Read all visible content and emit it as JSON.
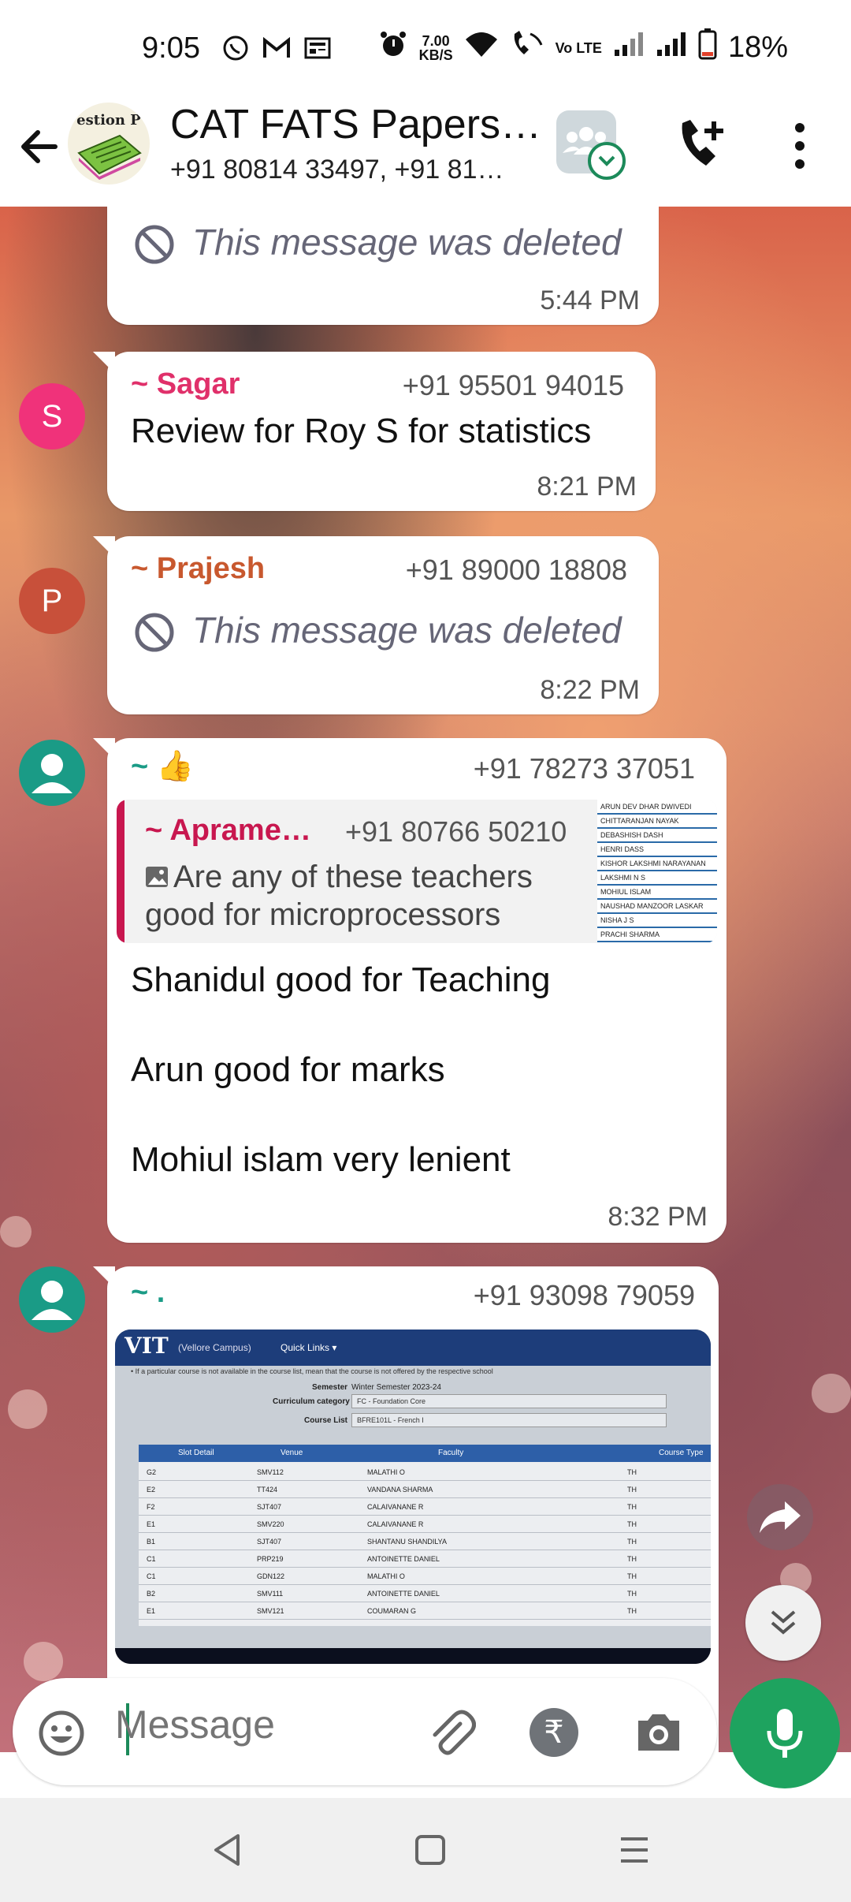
{
  "status_bar": {
    "time": "9:05",
    "speed_value": "7.00",
    "speed_unit": "KB/S",
    "volte": "Vo LTE",
    "battery": "18%"
  },
  "header": {
    "title": "CAT FATS Papers…",
    "subtitle": "+91 80814 33497, +91 81…",
    "avatar_text": "estion P"
  },
  "messages": [
    {
      "deleted_text": "This message was deleted",
      "time": "5:44 PM"
    },
    {
      "avatar_letter": "S",
      "avatar_color": "#f0327a",
      "sender": "~ Sagar",
      "sender_color": "#e0306a",
      "phone": "+91 95501 94015",
      "text": "Review for Roy S for statistics",
      "time": "8:21 PM"
    },
    {
      "avatar_letter": "P",
      "avatar_color": "#c8503a",
      "sender": "~ Prajesh",
      "sender_color": "#c8582e",
      "phone": "+91 89000 18808",
      "deleted_text": "This message was deleted",
      "time": "8:22 PM"
    },
    {
      "sender": "~ 👍",
      "sender_color": "#1a9b86",
      "phone": "+91 78273 37051",
      "quote": {
        "sender": "~ Aprame…",
        "phone": "+91 80766 50210",
        "line1": "Are any of these teachers",
        "line2": "good for microprocessors",
        "thumb_names": [
          "ARUN DEV DHAR DWIVEDI",
          "CHITTARANJAN NAYAK",
          "DEBASHISH DASH",
          "HENRI DASS",
          "KISHOR LAKSHMI NARAYANAN",
          "LAKSHMI N S",
          "MOHIUL ISLAM",
          "NAUSHAD MANZOOR LASKAR",
          "NISHA J S",
          "PRACHI SHARMA"
        ]
      },
      "lines": [
        "Shanidul good for Teaching",
        "Arun good for marks",
        "Mohiul islam  very lenient"
      ],
      "time": "8:32 PM"
    },
    {
      "sender": "~ .",
      "sender_color": "#1a9b86",
      "phone": "+91 93098 79059",
      "screenshot": {
        "logo": "VIT",
        "campus": "(Vellore Campus)",
        "menu": "Quick Links ▾",
        "note": "• If a particular course is not available in the course list, mean that the course is not offered by the respective school",
        "semester_label": "Semester",
        "semester_value": "Winter Semester 2023-24",
        "category_label": "Curriculum category",
        "category_value": "FC - Foundation Core",
        "course_label": "Course List",
        "course_value": "BFRE101L - French I",
        "columns": [
          "Slot Detail",
          "Venue",
          "Faculty",
          "Course Type"
        ],
        "rows": [
          [
            "G2",
            "SMV112",
            "MALATHI O",
            "TH"
          ],
          [
            "E2",
            "TT424",
            "VANDANA SHARMA",
            "TH"
          ],
          [
            "F2",
            "SJT407",
            "CALAIVANANE R",
            "TH"
          ],
          [
            "E1",
            "SMV220",
            "CALAIVANANE R",
            "TH"
          ],
          [
            "B1",
            "SJT407",
            "SHANTANU SHANDILYA",
            "TH"
          ],
          [
            "C1",
            "PRP219",
            "ANTOINETTE DANIEL",
            "TH"
          ],
          [
            "C1",
            "GDN122",
            "MALATHI O",
            "TH"
          ],
          [
            "B2",
            "SMV111",
            "ANTOINETTE DANIEL",
            "TH"
          ],
          [
            "E1",
            "SMV121",
            "COUMARAN G",
            "TH"
          ]
        ]
      }
    }
  ],
  "input": {
    "placeholder": "Message"
  }
}
